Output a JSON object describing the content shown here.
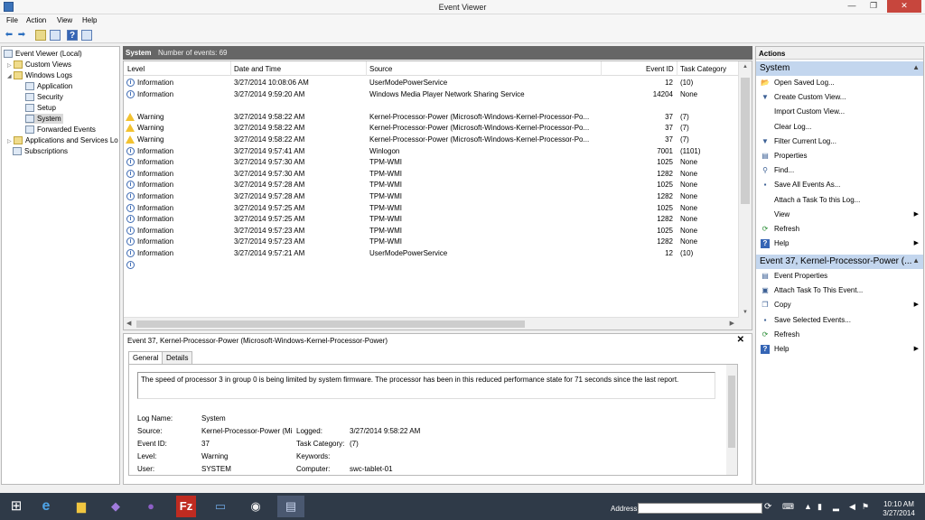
{
  "window": {
    "title": "Event Viewer",
    "minimize": "—",
    "maximize": "❐",
    "close": "✕"
  },
  "menu": [
    "File",
    "Action",
    "View",
    "Help"
  ],
  "tree": {
    "root": "Event Viewer (Local)",
    "custom_views": "Custom Views",
    "windows_logs": "Windows Logs",
    "logs": [
      "Application",
      "Security",
      "Setup",
      "System",
      "Forwarded Events"
    ],
    "apps_services": "Applications and Services Lo",
    "subscriptions": "Subscriptions"
  },
  "log_header": {
    "name": "System",
    "count": "Number of events: 69"
  },
  "columns": {
    "level": "Level",
    "date": "Date and Time",
    "source": "Source",
    "event_id": "Event ID",
    "task": "Task Category"
  },
  "events": [
    {
      "level": "Information",
      "date": "3/27/2014 10:08:06 AM",
      "source": "UserModePowerService",
      "id": "12",
      "task": "(10)",
      "icon": "info-icon"
    },
    {
      "level": "Information",
      "date": "3/27/2014 9:59:20 AM",
      "source": "Windows Media Player Network Sharing Service",
      "id": "14204",
      "task": "None",
      "icon": "info-icon"
    },
    {
      "level": "",
      "date": "",
      "source": "",
      "id": "",
      "task": "",
      "icon": "none"
    },
    {
      "level": "Warning",
      "date": "3/27/2014 9:58:22 AM",
      "source": "Kernel-Processor-Power (Microsoft-Windows-Kernel-Processor-Po...",
      "id": "37",
      "task": "(7)",
      "icon": "warning-icon"
    },
    {
      "level": "Warning",
      "date": "3/27/2014 9:58:22 AM",
      "source": "Kernel-Processor-Power (Microsoft-Windows-Kernel-Processor-Po...",
      "id": "37",
      "task": "(7)",
      "icon": "warning-icon"
    },
    {
      "level": "Warning",
      "date": "3/27/2014 9:58:22 AM",
      "source": "Kernel-Processor-Power (Microsoft-Windows-Kernel-Processor-Po...",
      "id": "37",
      "task": "(7)",
      "icon": "warning-icon"
    },
    {
      "level": "Information",
      "date": "3/27/2014 9:57:41 AM",
      "source": "Winlogon",
      "id": "7001",
      "task": "(1101)",
      "icon": "info-icon"
    },
    {
      "level": "Information",
      "date": "3/27/2014 9:57:30 AM",
      "source": "TPM-WMI",
      "id": "1025",
      "task": "None",
      "icon": "info-icon"
    },
    {
      "level": "Information",
      "date": "3/27/2014 9:57:30 AM",
      "source": "TPM-WMI",
      "id": "1282",
      "task": "None",
      "icon": "info-icon"
    },
    {
      "level": "Information",
      "date": "3/27/2014 9:57:28 AM",
      "source": "TPM-WMI",
      "id": "1025",
      "task": "None",
      "icon": "info-icon"
    },
    {
      "level": "Information",
      "date": "3/27/2014 9:57:28 AM",
      "source": "TPM-WMI",
      "id": "1282",
      "task": "None",
      "icon": "info-icon"
    },
    {
      "level": "Information",
      "date": "3/27/2014 9:57:25 AM",
      "source": "TPM-WMI",
      "id": "1025",
      "task": "None",
      "icon": "info-icon"
    },
    {
      "level": "Information",
      "date": "3/27/2014 9:57:25 AM",
      "source": "TPM-WMI",
      "id": "1282",
      "task": "None",
      "icon": "info-icon"
    },
    {
      "level": "Information",
      "date": "3/27/2014 9:57:23 AM",
      "source": "TPM-WMI",
      "id": "1025",
      "task": "None",
      "icon": "info-icon"
    },
    {
      "level": "Information",
      "date": "3/27/2014 9:57:23 AM",
      "source": "TPM-WMI",
      "id": "1282",
      "task": "None",
      "icon": "info-icon"
    },
    {
      "level": "Information",
      "date": "3/27/2014 9:57:21 AM",
      "source": "UserModePowerService",
      "id": "12",
      "task": "(10)",
      "icon": "info-icon"
    },
    {
      "level": "",
      "date": "",
      "source": "",
      "id": "",
      "task": "",
      "icon": "info-icon"
    }
  ],
  "detail": {
    "title": "Event 37, Kernel-Processor-Power (Microsoft-Windows-Kernel-Processor-Power)",
    "close": "✕",
    "tabs": [
      "General",
      "Details"
    ],
    "message": "The speed of processor 3 in group 0 is being limited by system firmware. The processor has been in this reduced performance state for 71 seconds since the last report.",
    "fields": {
      "log_name_label": "Log Name:",
      "log_name": "System",
      "source_label": "Source:",
      "source": "Kernel-Processor-Power (Mi",
      "logged_label": "Logged:",
      "logged": "3/27/2014 9:58:22 AM",
      "event_id_label": "Event ID:",
      "event_id": "37",
      "task_label": "Task Category:",
      "task": "(7)",
      "level_label": "Level:",
      "level": "Warning",
      "keywords_label": "Keywords:",
      "user_label": "User:",
      "user": "SYSTEM",
      "computer_label": "Computer:",
      "computer": "swc-tablet-01"
    }
  },
  "actions": {
    "header": "Actions",
    "section1": "System",
    "items1": [
      {
        "label": "Open Saved Log...",
        "icon": "folder-open-icon",
        "glyph": "📂",
        "arrow": ""
      },
      {
        "label": "Create Custom View...",
        "icon": "filter-icon",
        "glyph": "▼",
        "arrow": ""
      },
      {
        "label": "Import Custom View...",
        "icon": "blank-icon",
        "glyph": "",
        "arrow": ""
      },
      {
        "label": "Clear Log...",
        "icon": "blank-icon",
        "glyph": "",
        "arrow": ""
      },
      {
        "label": "Filter Current Log...",
        "icon": "filter-icon",
        "glyph": "▼",
        "arrow": ""
      },
      {
        "label": "Properties",
        "icon": "properties-icon",
        "glyph": "▤",
        "arrow": ""
      },
      {
        "label": "Find...",
        "icon": "find-icon",
        "glyph": "⚲",
        "arrow": ""
      },
      {
        "label": "Save All Events As...",
        "icon": "save-icon",
        "glyph": "▪",
        "arrow": ""
      },
      {
        "label": "Attach a Task To this Log...",
        "icon": "blank-icon",
        "glyph": "",
        "arrow": ""
      },
      {
        "label": "View",
        "icon": "blank-icon",
        "glyph": "",
        "arrow": "▶"
      },
      {
        "label": "Refresh",
        "icon": "refresh-icon",
        "glyph": "⟳",
        "arrow": ""
      },
      {
        "label": "Help",
        "icon": "help-icon",
        "glyph": "?",
        "arrow": "▶"
      }
    ],
    "section2": "Event 37, Kernel-Processor-Power (...",
    "items2": [
      {
        "label": "Event Properties",
        "icon": "event-properties-icon",
        "glyph": "▤",
        "arrow": ""
      },
      {
        "label": "Attach Task To This Event...",
        "icon": "task-icon",
        "glyph": "▣",
        "arrow": ""
      },
      {
        "label": "Copy",
        "icon": "copy-icon",
        "glyph": "❐",
        "arrow": "▶"
      },
      {
        "label": "Save Selected Events...",
        "icon": "save-icon",
        "glyph": "▪",
        "arrow": ""
      },
      {
        "label": "Refresh",
        "icon": "refresh-icon",
        "glyph": "⟳",
        "arrow": ""
      },
      {
        "label": "Help",
        "icon": "help-icon",
        "glyph": "?",
        "arrow": "▶"
      }
    ]
  },
  "taskbar": {
    "address_label": "Address",
    "time": "10:10 AM",
    "date": "3/27/2014"
  },
  "colors": {
    "selection": "#d9d9d9",
    "section_header": "#c3d6ee",
    "taskbar": "#2f3a48",
    "close_button": "#c7463d"
  }
}
